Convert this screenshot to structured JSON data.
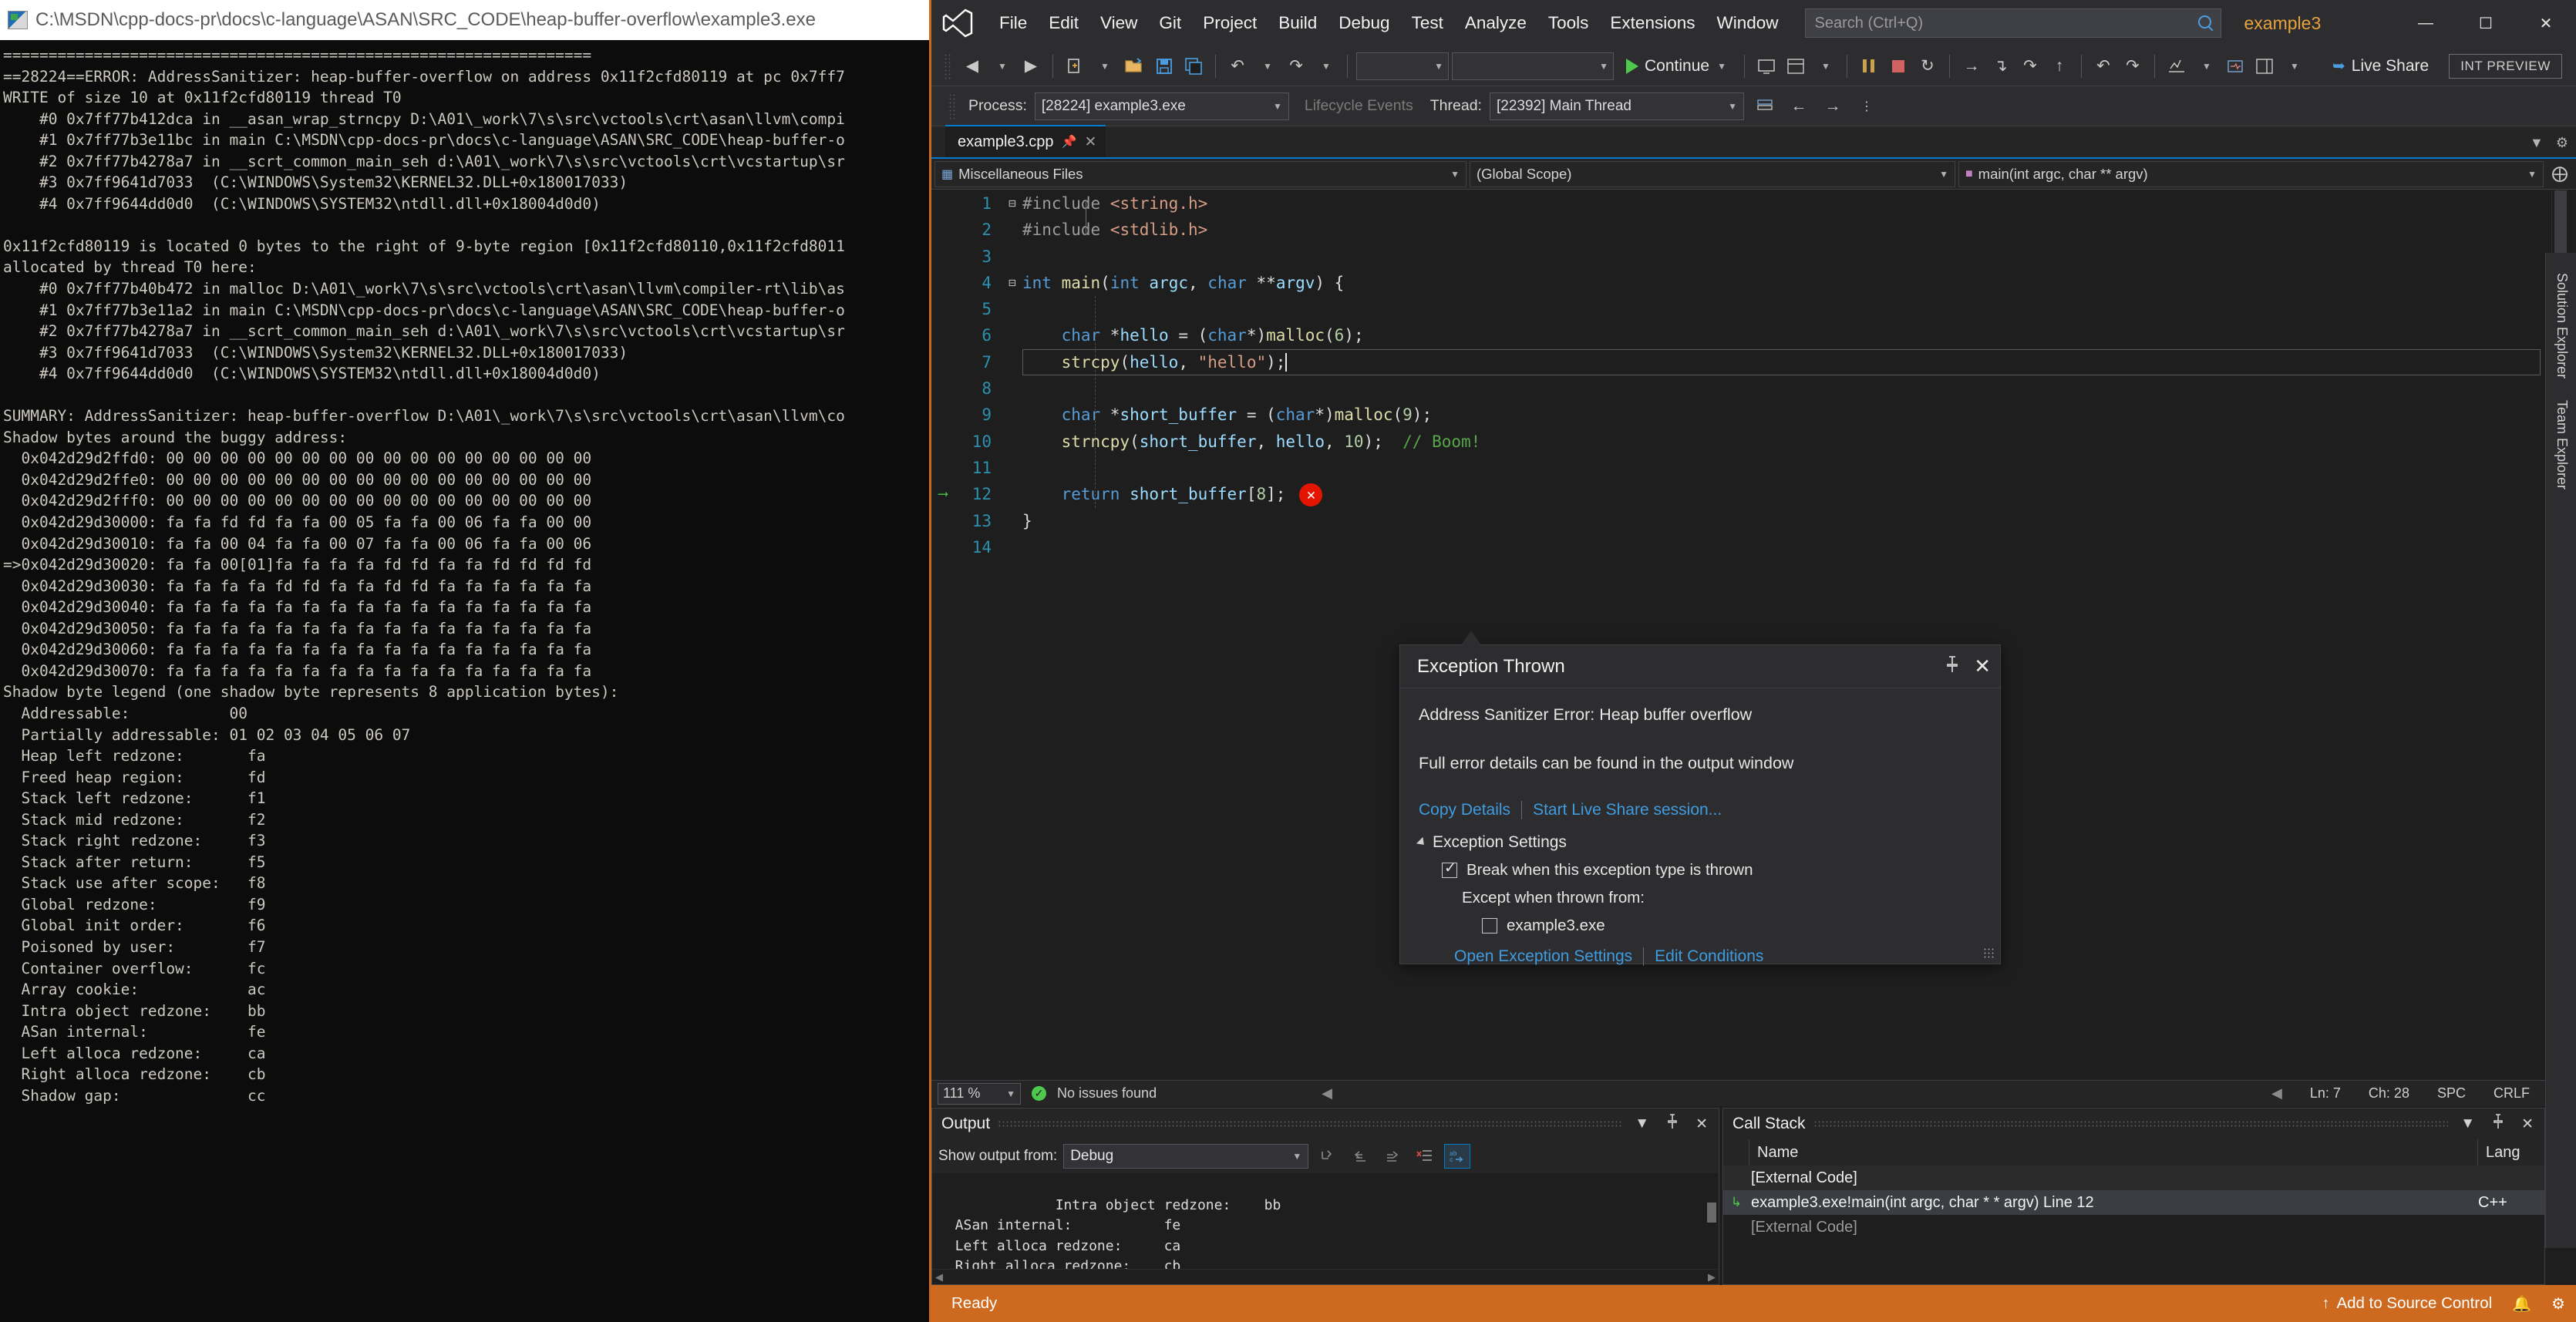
{
  "console": {
    "title": "C:\\MSDN\\cpp-docs-pr\\docs\\c-language\\ASAN\\SRC_CODE\\heap-buffer-overflow\\example3.exe",
    "icon": "console-icon",
    "text": "=================================================================\n==28224==ERROR: AddressSanitizer: heap-buffer-overflow on address 0x11f2cfd80119 at pc 0x7ff7\nWRITE of size 10 at 0x11f2cfd80119 thread T0\n    #0 0x7ff77b412dca in __asan_wrap_strncpy D:\\A01\\_work\\7\\s\\src\\vctools\\crt\\asan\\llvm\\compi\n    #1 0x7ff77b3e11bc in main C:\\MSDN\\cpp-docs-pr\\docs\\c-language\\ASAN\\SRC_CODE\\heap-buffer-o\n    #2 0x7ff77b4278a7 in __scrt_common_main_seh d:\\A01\\_work\\7\\s\\src\\vctools\\crt\\vcstartup\\sr\n    #3 0x7ff9641d7033  (C:\\WINDOWS\\System32\\KERNEL32.DLL+0x180017033)\n    #4 0x7ff9644dd0d0  (C:\\WINDOWS\\SYSTEM32\\ntdll.dll+0x18004d0d0)\n\n0x11f2cfd80119 is located 0 bytes to the right of 9-byte region [0x11f2cfd80110,0x11f2cfd8011\nallocated by thread T0 here:\n    #0 0x7ff77b40b472 in malloc D:\\A01\\_work\\7\\s\\src\\vctools\\crt\\asan\\llvm\\compiler-rt\\lib\\as\n    #1 0x7ff77b3e11a2 in main C:\\MSDN\\cpp-docs-pr\\docs\\c-language\\ASAN\\SRC_CODE\\heap-buffer-o\n    #2 0x7ff77b4278a7 in __scrt_common_main_seh d:\\A01\\_work\\7\\s\\src\\vctools\\crt\\vcstartup\\sr\n    #3 0x7ff9641d7033  (C:\\WINDOWS\\System32\\KERNEL32.DLL+0x180017033)\n    #4 0x7ff9644dd0d0  (C:\\WINDOWS\\SYSTEM32\\ntdll.dll+0x18004d0d0)\n\nSUMMARY: AddressSanitizer: heap-buffer-overflow D:\\A01\\_work\\7\\s\\src\\vctools\\crt\\asan\\llvm\\co\nShadow bytes around the buggy address:\n  0x042d29d2ffd0: 00 00 00 00 00 00 00 00 00 00 00 00 00 00 00 00\n  0x042d29d2ffe0: 00 00 00 00 00 00 00 00 00 00 00 00 00 00 00 00\n  0x042d29d2fff0: 00 00 00 00 00 00 00 00 00 00 00 00 00 00 00 00\n  0x042d29d30000: fa fa fd fd fa fa 00 05 fa fa 00 06 fa fa 00 00\n  0x042d29d30010: fa fa 00 04 fa fa 00 07 fa fa 00 06 fa fa 00 06\n=>0x042d29d30020: fa fa 00[01]fa fa fa fa fd fd fa fa fd fd fd fd\n  0x042d29d30030: fa fa fa fa fd fd fa fa fd fd fa fa fa fa fa fa\n  0x042d29d30040: fa fa fa fa fa fa fa fa fa fa fa fa fa fa fa fa\n  0x042d29d30050: fa fa fa fa fa fa fa fa fa fa fa fa fa fa fa fa\n  0x042d29d30060: fa fa fa fa fa fa fa fa fa fa fa fa fa fa fa fa\n  0x042d29d30070: fa fa fa fa fa fa fa fa fa fa fa fa fa fa fa fa\nShadow byte legend (one shadow byte represents 8 application bytes):\n  Addressable:           00\n  Partially addressable: 01 02 03 04 05 06 07\n  Heap left redzone:       fa\n  Freed heap region:       fd\n  Stack left redzone:      f1\n  Stack mid redzone:       f2\n  Stack right redzone:     f3\n  Stack after return:      f5\n  Stack use after scope:   f8\n  Global redzone:          f9\n  Global init order:       f6\n  Poisoned by user:        f7\n  Container overflow:      fc\n  Array cookie:            ac\n  Intra object redzone:    bb\n  ASan internal:           fe\n  Left alloca redzone:     ca\n  Right alloca redzone:    cb\n  Shadow gap:              cc"
  },
  "vs": {
    "logo_glyph": "✗",
    "menu": [
      "File",
      "Edit",
      "View",
      "Git",
      "Project",
      "Build",
      "Debug",
      "Test",
      "Analyze",
      "Tools",
      "Extensions",
      "Window"
    ],
    "search_placeholder": "Search (Ctrl+Q)",
    "solution_tab": "example3",
    "window_buttons": {
      "minimize": "—",
      "maximize": "☐",
      "close": "✕"
    },
    "toolbar": {
      "back": "◀",
      "forward": "▶",
      "new_item": "new-item",
      "open_file": "open-file",
      "save": "save",
      "save_all": "save-all",
      "undo": "↶",
      "redo": "↷",
      "config_combo": "",
      "platform_combo": "",
      "continue_label": "Continue",
      "live_share_label": "Live Share",
      "preview_badge": "INT PREVIEW"
    },
    "debugbar": {
      "process_label": "Process:",
      "process_value": "[28224] example3.exe",
      "lifecycle_label": "Lifecycle Events",
      "thread_label": "Thread:",
      "thread_value": "[22392] Main Thread"
    },
    "doc_tab": {
      "name": "example3.cpp",
      "pin": "—",
      "close": "✕"
    },
    "navbar": {
      "scope_left": "Miscellaneous Files",
      "scope_mid": "(Global Scope)",
      "scope_right": "main(int argc, char ** argv)"
    },
    "right_tool_tabs": [
      "Solution Explorer",
      "Team Explorer"
    ],
    "editor": {
      "lines": [
        {
          "n": "1",
          "fold": "⊟",
          "indent": 0
        },
        {
          "n": "2",
          "fold": "",
          "indent": 0
        },
        {
          "n": "3",
          "fold": "",
          "indent": 0
        },
        {
          "n": "4",
          "fold": "⊟",
          "indent": 0
        },
        {
          "n": "5",
          "fold": "",
          "indent": 1
        },
        {
          "n": "6",
          "fold": "",
          "indent": 1
        },
        {
          "n": "7",
          "fold": "",
          "indent": 1
        },
        {
          "n": "8",
          "fold": "",
          "indent": 1
        },
        {
          "n": "9",
          "fold": "",
          "indent": 1
        },
        {
          "n": "10",
          "fold": "",
          "indent": 1
        },
        {
          "n": "11",
          "fold": "",
          "indent": 1
        },
        {
          "n": "12",
          "fold": "",
          "indent": 1
        },
        {
          "n": "13",
          "fold": "",
          "indent": 0
        },
        {
          "n": "14",
          "fold": "",
          "indent": 0
        }
      ],
      "code_plain": [
        "#include <string.h>",
        "#include <stdlib.h>",
        "",
        "int main(int argc, char **argv) {",
        "",
        "    char *hello = (char*)malloc(6);",
        "    strcpy(hello, \"hello\");",
        "",
        "    char *short_buffer = (char*)malloc(9);",
        "    strncpy(short_buffer, hello, 10);  // Boom!",
        "",
        "    return short_buffer[8];",
        "}",
        ""
      ],
      "current_line": 7,
      "exec_arrow_line": 12,
      "error_marker": "✕",
      "zoom": "111 %",
      "issues": "No issues found",
      "ln": "Ln: 7",
      "ch": "Ch: 28",
      "spc": "SPC",
      "crlf": "CRLF"
    },
    "exception_dialog": {
      "title": "Exception Thrown",
      "pin_icon": "📌",
      "close_icon": "✕",
      "message": "Address Sanitizer Error: Heap buffer overflow",
      "detail": "Full error details can be found in the output window",
      "copy_details": "Copy Details",
      "live_share": "Start Live Share session...",
      "settings_header": "Exception Settings",
      "break_checkbox_label": "Break when this exception type is thrown",
      "break_checked": true,
      "except_when_label": "Except when thrown from:",
      "except_item": "example3.exe",
      "except_item_checked": false,
      "open_settings": "Open Exception Settings",
      "edit_conditions": "Edit Conditions"
    },
    "output_panel": {
      "title": "Output",
      "show_output_from_label": "Show output from:",
      "source": "Debug",
      "text": "  Intra object redzone:    bb\n  ASan internal:           fe\n  Left alloca redzone:     ca\n  Right alloca redzone:    cb\n  Shadow gap:              cc\nAddress Sanitizer Error: Heap buffer overflow",
      "toolbar_icons": [
        "find-message",
        "go-to-previous",
        "go-to-next",
        "clear-all",
        "toggle-word-wrap"
      ]
    },
    "callstack_panel": {
      "title": "Call Stack",
      "columns": [
        "Name",
        "Lang"
      ],
      "rows": [
        {
          "glyph": "",
          "name": "[External Code]",
          "lang": "",
          "selected": false,
          "dim": false
        },
        {
          "glyph": "↳",
          "name": "example3.exe!main(int argc, char * * argv) Line 12",
          "lang": "C++",
          "selected": true,
          "dim": false
        },
        {
          "glyph": "",
          "name": "[External Code]",
          "lang": "",
          "selected": false,
          "dim": true
        }
      ]
    },
    "statusbar": {
      "state": "Ready",
      "add_to_source_control": "Add to Source Control",
      "up_icon": "↑",
      "bell_icon": "🔔",
      "gear_icon": "⚙"
    }
  },
  "colors": {
    "accent_orange": "#ce6a1f",
    "accent_blue": "#007acc",
    "error_red": "#e51400",
    "ok_green": "#4ec94e",
    "link_blue": "#3f9cdf"
  }
}
